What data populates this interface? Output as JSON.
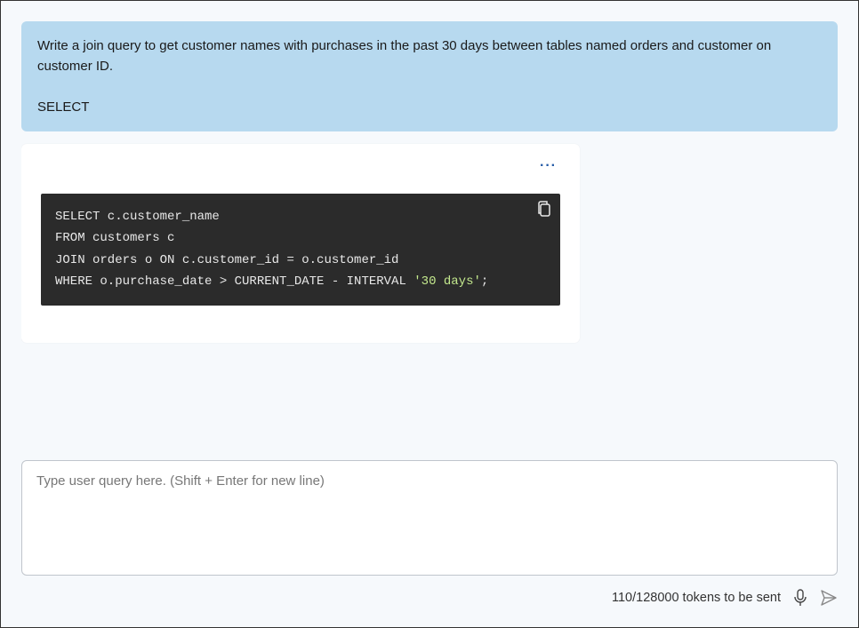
{
  "user_message": {
    "prompt_text": "Write a join query to get customer names with purchases in the past 30 days between tables named orders and customer on customer ID.",
    "code_prefix": "SELECT"
  },
  "response": {
    "more_label": "···",
    "code": {
      "line1": "SELECT c.customer_name",
      "line2": "FROM customers c",
      "line3": "JOIN orders o ON c.customer_id = o.customer_id",
      "line4_prefix": "WHERE o.purchase_date > CURRENT_DATE - INTERVAL ",
      "line4_string": "'30 days'",
      "line4_suffix": ";"
    }
  },
  "input": {
    "placeholder": "Type user query here. (Shift + Enter for new line)"
  },
  "status": {
    "tokens_text": "110/128000 tokens to be sent"
  }
}
